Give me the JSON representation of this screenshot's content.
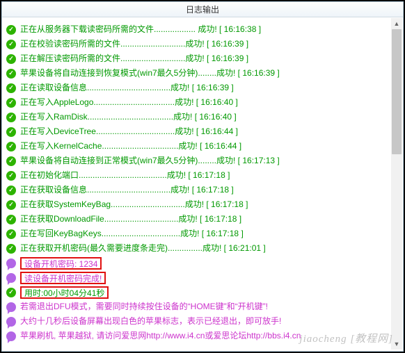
{
  "title": "日志输出",
  "watermark": "jiaocheng [教程网]",
  "logs": [
    {
      "icon": "success",
      "style": "green",
      "text": "正在从服务器下载读密码所需的文件.................. 成功! [ 16:16:38 ]"
    },
    {
      "icon": "success",
      "style": "green",
      "text": "正在校验读密码所需的文件............................成功! [ 16:16:39 ]"
    },
    {
      "icon": "success",
      "style": "green",
      "text": "正在解压读密码所需的文件............................成功! [ 16:16:39 ]"
    },
    {
      "icon": "success",
      "style": "green",
      "text": "苹果设备将自动连接到恢复模式(win7最久5分钟)........成功! [ 16:16:39 ]"
    },
    {
      "icon": "success",
      "style": "green",
      "text": "正在读取设备信息....................................成功! [ 16:16:39 ]"
    },
    {
      "icon": "success",
      "style": "green",
      "text": "正在写入AppleLogo...................................成功! [ 16:16:40 ]"
    },
    {
      "icon": "success",
      "style": "green",
      "text": "正在写入RamDisk.....................................成功! [ 16:16:40 ]"
    },
    {
      "icon": "success",
      "style": "green",
      "text": "正在写入DeviceTree..................................成功! [ 16:16:44 ]"
    },
    {
      "icon": "success",
      "style": "green",
      "text": "正在写入KernelCache.................................成功! [ 16:16:44 ]"
    },
    {
      "icon": "success",
      "style": "green",
      "text": "苹果设备将自动连接到正常模式(win7最久5分钟)........成功! [ 16:17:13 ]"
    },
    {
      "icon": "success",
      "style": "green",
      "text": "正在初始化端口......................................成功! [ 16:17:18 ]"
    },
    {
      "icon": "success",
      "style": "green",
      "text": "正在获取设备信息....................................成功! [ 16:17:18 ]"
    },
    {
      "icon": "success",
      "style": "green",
      "text": "正在获取SystemKeyBag................................成功! [ 16:17:18 ]"
    },
    {
      "icon": "success",
      "style": "green",
      "text": "正在获取DownloadFile................................成功! [ 16:17:18 ]"
    },
    {
      "icon": "success",
      "style": "green",
      "text": "正在写回KeyBagKeys..................................成功! [ 16:17:18 ]"
    },
    {
      "icon": "success",
      "style": "green",
      "text": "正在获取开机密码(最久需要进度条走完)...............成功! [ 16:21:01 ]"
    },
    {
      "icon": "info",
      "style": "purple",
      "highlight": true,
      "text": "设备开机密码: 1234"
    },
    {
      "icon": "info",
      "style": "purple",
      "highlight": true,
      "text": "读设备开机密码完成!"
    },
    {
      "icon": "success",
      "style": "green",
      "highlight": true,
      "text": "用时:00小时04分41秒"
    },
    {
      "icon": "info",
      "style": "purple",
      "text": "若需退出DFU模式，需要同时持续按住设备的“HOME键”和“开机键”!"
    },
    {
      "icon": "info",
      "style": "purple",
      "text": "大约十几秒后设备屏幕出现白色的苹果标志，表示已经退出，即可放手!"
    },
    {
      "icon": "info",
      "style": "purple",
      "text": "苹果刷机, 苹果越狱, 请访问爱思网http://www.i4.cn或爱思论坛http://bbs.i4.cn"
    }
  ]
}
